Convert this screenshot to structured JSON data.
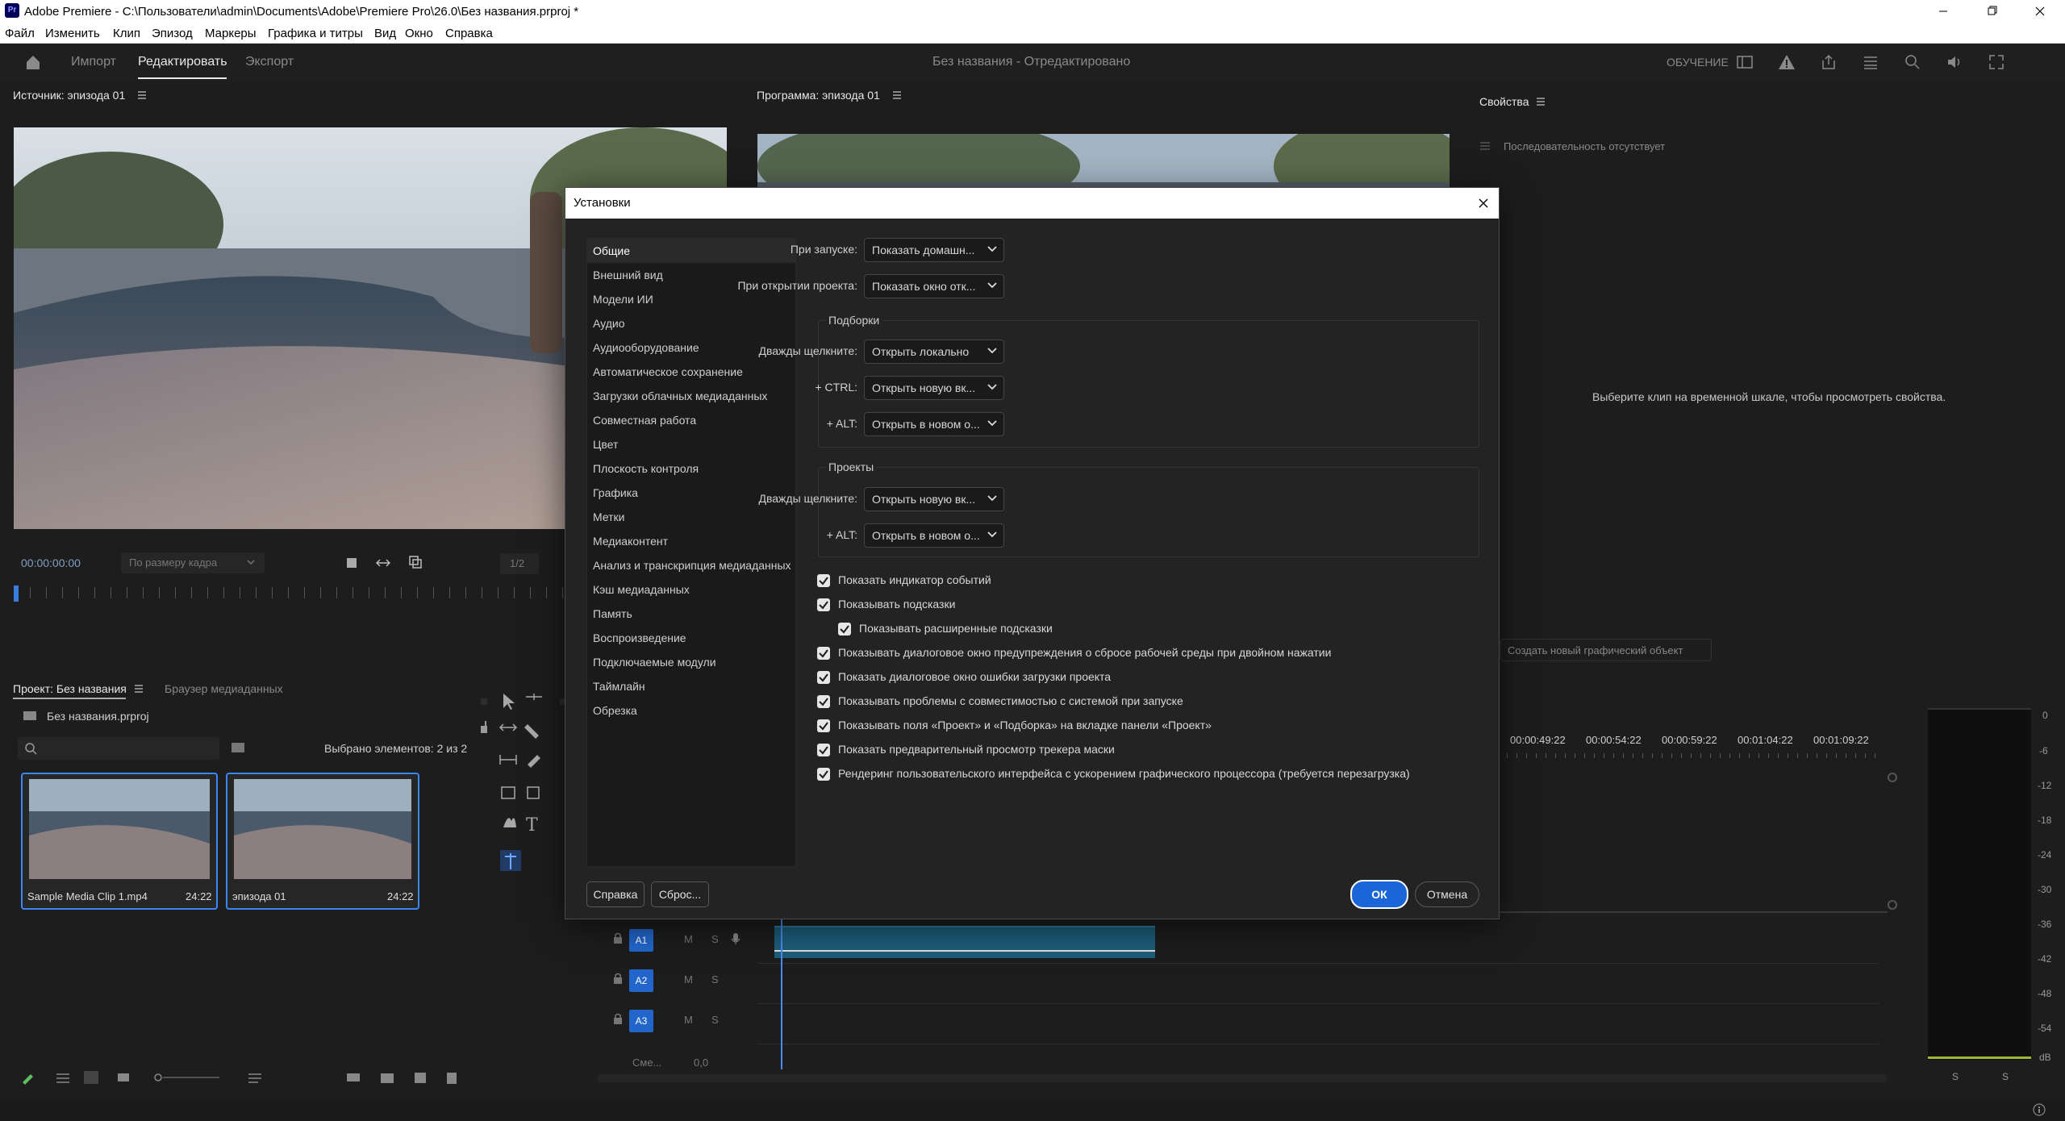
{
  "window": {
    "title": "Adobe Premiere - C:\\Пользователи\\admin\\Documents\\Adobe\\Premiere Pro\\26.0\\Без названия.prproj *",
    "logo": "Pr"
  },
  "menu": [
    "Файл",
    "Изменить",
    "Клип",
    "Эпизод",
    "Маркеры",
    "Графика и титры",
    "Вид",
    "Окно",
    "Справка"
  ],
  "header": {
    "tabs": [
      "Импорт",
      "Редактировать",
      "Экспорт"
    ],
    "active_tab": "Редактировать",
    "doc_title": "Без названия - Отредактировано",
    "learn": "ОБУЧЕНИЕ"
  },
  "source_monitor": {
    "title": "Источник: эпизода 01",
    "timecode": "00:00:00:00",
    "fit": "По размеру кадра",
    "resolution": "1/2"
  },
  "program_monitor": {
    "title": "Программа: эпизода 01"
  },
  "properties": {
    "title": "Свойства",
    "no_sequence": "Последовательность отсутствует",
    "hint": "Выберите клип на временной шкале, чтобы просмотреть свойства.",
    "new_graphic": "Создать новый графический объект"
  },
  "project": {
    "tab": "Проект: Без названия",
    "tab2": "Браузер медиаданных",
    "file": "Без названия.prproj",
    "selected": "Выбрано элементов: 2 из 2",
    "items": [
      {
        "name": "Sample Media Clip 1.mp4",
        "duration": "24:22"
      },
      {
        "name": "эпизода 01",
        "duration": "24:22"
      }
    ]
  },
  "timeline": {
    "ruler": [
      "00:00:49:22",
      "00:00:54:22",
      "00:00:59:22",
      "00:01:04:22",
      "00:01:09:22"
    ],
    "tracks": [
      "A1",
      "A2",
      "A3"
    ],
    "track_letters": {
      "m": "M",
      "s": "S"
    },
    "mix_label": "Сме...",
    "mix_value": "0,0"
  },
  "meter": {
    "scale": [
      "0",
      "-6",
      "-12",
      "-18",
      "-24",
      "-30",
      "-36",
      "-42",
      "-48",
      "-54",
      "dB"
    ],
    "channels": [
      "S",
      "S"
    ]
  },
  "dialog": {
    "title": "Установки",
    "nav": [
      "Общие",
      "Внешний вид",
      "Модели ИИ",
      "Аудио",
      "Аудиооборудование",
      "Автоматическое сохранение",
      "Загрузки облачных медиаданных",
      "Совместная работа",
      "Цвет",
      "Плоскость контроля",
      "Графика",
      "Метки",
      "Медиаконтент",
      "Анализ и транскрипция медиаданных",
      "Кэш медиаданных",
      "Память",
      "Воспроизведение",
      "Подключаемые модули",
      "Таймлайн",
      "Обрезка"
    ],
    "selected_nav": "Общие",
    "startup": {
      "label": "При запуске:",
      "value": "Показать домашн..."
    },
    "open_project": {
      "label": "При открытии проекта:",
      "value": "Показать окно отк..."
    },
    "bins": {
      "title": "Подборки",
      "rows": [
        {
          "label": "Дважды щелкните:",
          "value": "Открыть локально"
        },
        {
          "label": "+ CTRL:",
          "value": "Открыть новую вк..."
        },
        {
          "label": "+ ALT:",
          "value": "Открыть в новом о..."
        }
      ]
    },
    "projects": {
      "title": "Проекты",
      "rows": [
        {
          "label": "Дважды щелкните:",
          "value": "Открыть новую вк..."
        },
        {
          "label": "+ ALT:",
          "value": "Открыть в новом о..."
        }
      ]
    },
    "checkboxes": [
      {
        "label": "Показать индикатор событий",
        "checked": true,
        "indent": false
      },
      {
        "label": "Показывать подсказки",
        "checked": true,
        "indent": false
      },
      {
        "label": "Показывать расширенные подсказки",
        "checked": true,
        "indent": true
      },
      {
        "label": "Показывать диалоговое окно предупреждения о сбросе рабочей среды при двойном нажатии",
        "checked": true,
        "indent": false
      },
      {
        "label": "Показать диалоговое окно ошибки загрузки проекта",
        "checked": true,
        "indent": false
      },
      {
        "label": "Показывать проблемы с совместимостью с системой при запуске",
        "checked": true,
        "indent": false
      },
      {
        "label": "Показывать поля «Проект» и «Подборка» на вкладке панели «Проект»",
        "checked": true,
        "indent": false
      },
      {
        "label": "Показать предварительный просмотр трекера маски",
        "checked": true,
        "indent": false
      },
      {
        "label": "Рендеринг пользовательского интерфейса с ускорением графического процессора (требуется перезагрузка)",
        "checked": true,
        "indent": false
      }
    ],
    "buttons": {
      "help": "Справка",
      "reset": "Сброс...",
      "ok": "ОК",
      "cancel": "Отмена"
    }
  }
}
